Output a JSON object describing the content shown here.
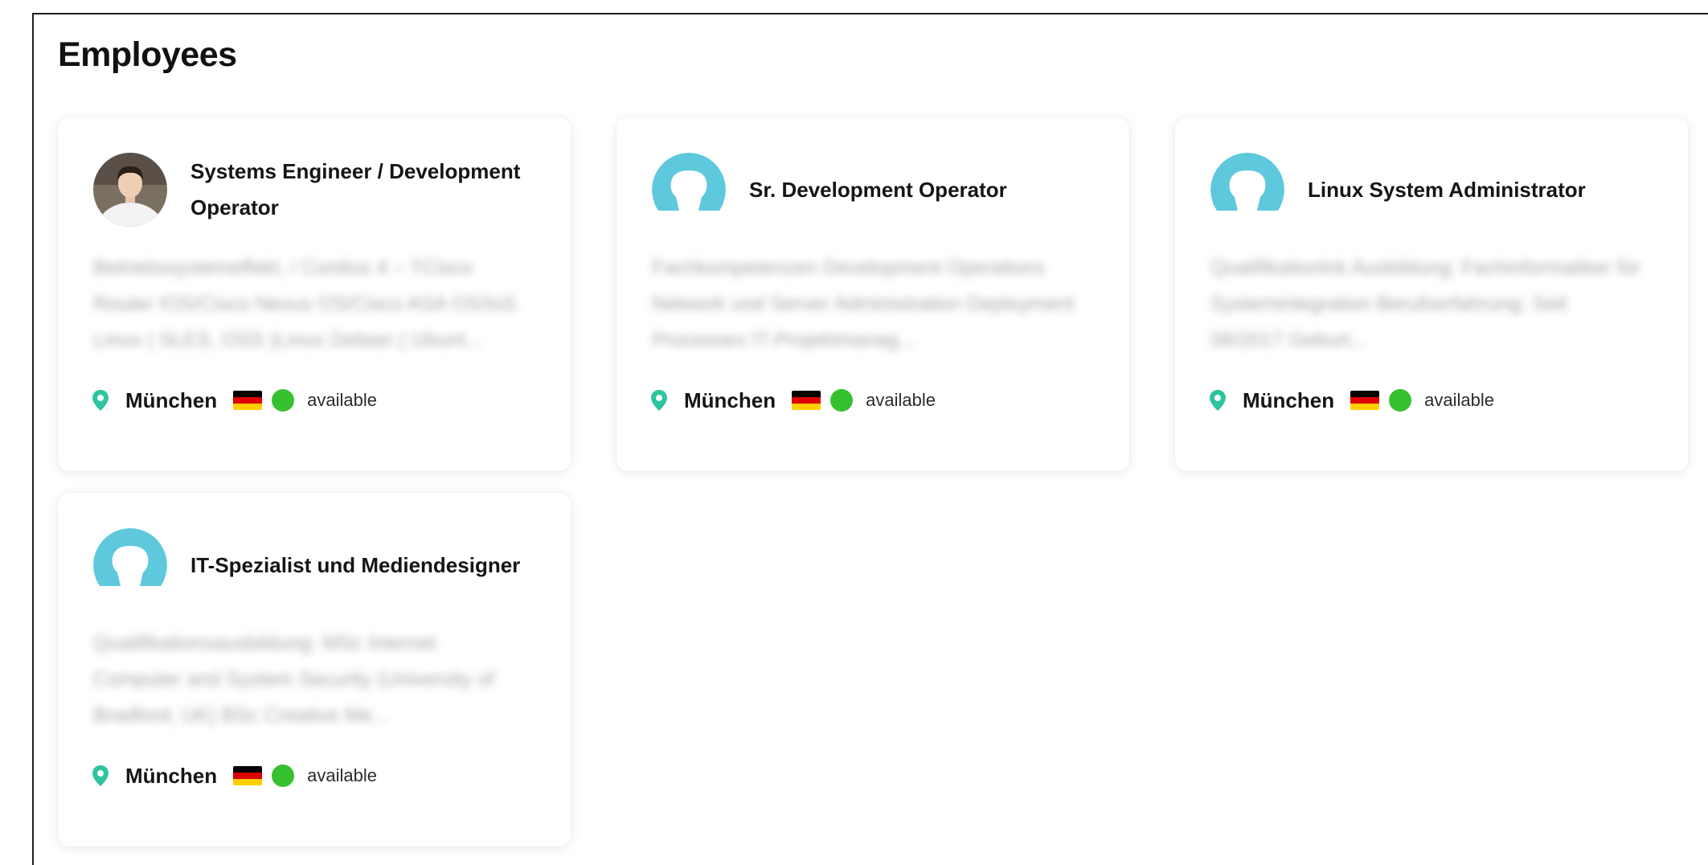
{
  "page": {
    "title": "Employees"
  },
  "theme": {
    "avatar_color": "#5ec8dc",
    "pin_color": "#2ec4a0",
    "status_color": "#36c22e",
    "flag_colors": [
      "#000000",
      "#dd0000",
      "#ffce00"
    ]
  },
  "cards": [
    {
      "avatar_type": "photo",
      "title": "Systems Engineer / Development Operator",
      "summary": "Betriebssystemeffekt, / Cordius 4 – TCisco Router IOS/Cisco Nexus OS/Cisco ASA OS/IoS Linux ( SLES, OSS )Linux Debian ( Ubunt...",
      "location_icon": "map-pin-icon",
      "city": "München",
      "country_flag": "germany-flag-icon",
      "status": "available"
    },
    {
      "avatar_type": "placeholder",
      "title": "Sr. Development Operator",
      "summary": "Fachkompetenzen Development Operations Network und Server Administration Deployment Processes IT-Projektmanag...",
      "location_icon": "map-pin-icon",
      "city": "München",
      "country_flag": "germany-flag-icon",
      "status": "available"
    },
    {
      "avatar_type": "placeholder",
      "title": "Linux System Administrator",
      "summary": "Qualifikationlnk Ausbildung: Fachinformatiker für Systemintegration Berufserfahrung: Seit 08/2017 Geburt...",
      "location_icon": "map-pin-icon",
      "city": "München",
      "country_flag": "germany-flag-icon",
      "status": "available"
    },
    {
      "avatar_type": "placeholder",
      "title": "IT-Spezialist und Mediendesigner",
      "summary": "Qualifikationsausbildung: MSc Internet Computer and System Security (University of Bradford, UK) BSc Creative Me...",
      "location_icon": "map-pin-icon",
      "city": "München",
      "country_flag": "germany-flag-icon",
      "status": "available"
    }
  ]
}
